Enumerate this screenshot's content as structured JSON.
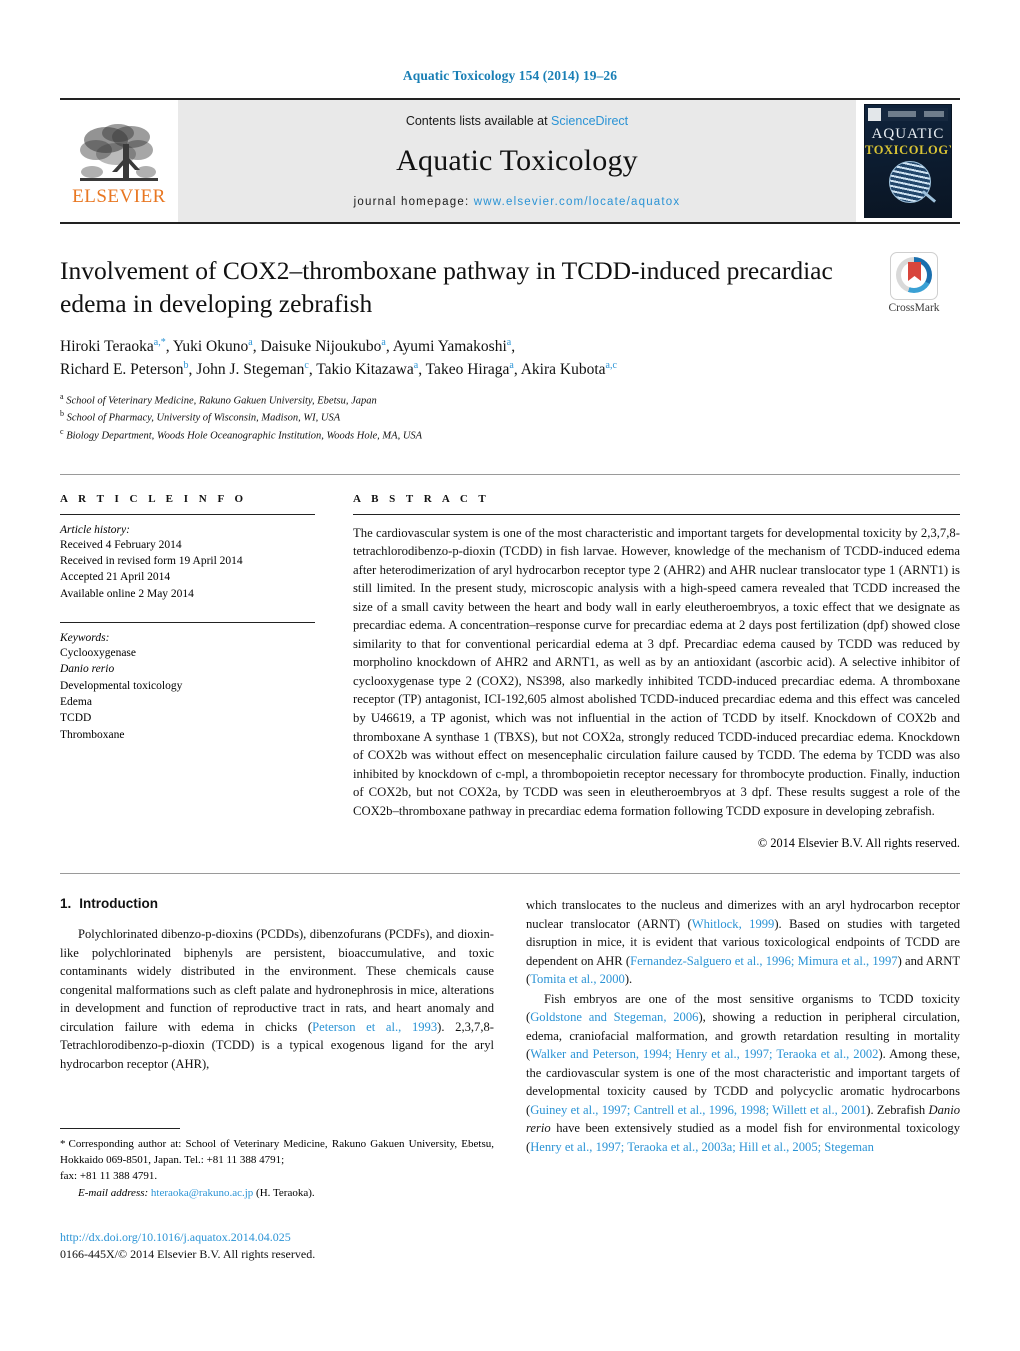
{
  "running_head": "Aquatic Toxicology 154 (2014) 19–26",
  "masthead": {
    "publisher_name": "ELSEVIER",
    "contents_prefix": "Contents lists available at ",
    "contents_link": "ScienceDirect",
    "journal_name": "Aquatic Toxicology",
    "homepage_prefix": "journal homepage: ",
    "homepage_url": "www.elsevier.com/locate/aquatox",
    "cover": {
      "line1": "AQUATIC",
      "line2": "TOXICOLOGY"
    }
  },
  "article": {
    "title": "Involvement of COX2–thromboxane pathway in TCDD-induced precardiac edema in developing zebrafish",
    "crossmark_label": "CrossMark",
    "authors_line1": "Hiroki Teraoka",
    "authors_html_line1": "Hiroki Teraoka a,*, Yuki Okuno a, Daisuke Nijoukubo a, Ayumi Yamakoshi a,",
    "authors_html_line2": "Richard E. Peterson b, John J. Stegeman c, Takio Kitazawa a, Takeo Hiraga a, Akira Kubota a,c",
    "affiliations": [
      {
        "marker": "a",
        "text": "School of Veterinary Medicine, Rakuno Gakuen University, Ebetsu, Japan"
      },
      {
        "marker": "b",
        "text": "School of Pharmacy, University of Wisconsin, Madison, WI, USA"
      },
      {
        "marker": "c",
        "text": "Biology Department, Woods Hole Oceanographic Institution, Woods Hole, MA, USA"
      }
    ]
  },
  "article_info": {
    "heading": "A R T I C L E   I N F O",
    "history_label": "Article history:",
    "history": [
      "Received 4 February 2014",
      "Received in revised form 19 April 2014",
      "Accepted 21 April 2014",
      "Available online 2 May 2014"
    ],
    "keywords_label": "Keywords:",
    "keywords": [
      "Cyclooxygenase",
      "Danio rerio",
      "Developmental toxicology",
      "Edema",
      "TCDD",
      "Thromboxane"
    ]
  },
  "abstract": {
    "heading": "A B S T R A C T",
    "text": "The cardiovascular system is one of the most characteristic and important targets for developmental toxicity by 2,3,7,8-tetrachlorodibenzo-p-dioxin (TCDD) in fish larvae. However, knowledge of the mechanism of TCDD-induced edema after heterodimerization of aryl hydrocarbon receptor type 2 (AHR2) and AHR nuclear translocator type 1 (ARNT1) is still limited. In the present study, microscopic analysis with a high-speed camera revealed that TCDD increased the size of a small cavity between the heart and body wall in early eleutheroembryos, a toxic effect that we designate as precardiac edema. A concentration–response curve for precardiac edema at 2 days post fertilization (dpf) showed close similarity to that for conventional pericardial edema at 3 dpf. Precardiac edema caused by TCDD was reduced by morpholino knockdown of AHR2 and ARNT1, as well as by an antioxidant (ascorbic acid). A selective inhibitor of cyclooxygenase type 2 (COX2), NS398, also markedly inhibited TCDD-induced precardiac edema. A thromboxane receptor (TP) antagonist, ICI-192,605 almost abolished TCDD-induced precardiac edema and this effect was canceled by U46619, a TP agonist, which was not influential in the action of TCDD by itself. Knockdown of COX2b and thromboxane A synthase 1 (TBXS), but not COX2a, strongly reduced TCDD-induced precardiac edema. Knockdown of COX2b was without effect on mesencephalic circulation failure caused by TCDD. The edema by TCDD was also inhibited by knockdown of c-mpl, a thrombopoietin receptor necessary for thrombocyte production. Finally, induction of COX2b, but not COX2a, by TCDD was seen in eleutheroembryos at 3 dpf. These results suggest a role of the COX2b–thromboxane pathway in precardiac edema formation following TCDD exposure in developing zebrafish.",
    "copyright": "© 2014 Elsevier B.V. All rights reserved."
  },
  "body": {
    "section_number": "1.",
    "section_title": "Introduction",
    "left_para_1_a": "Polychlorinated dibenzo-p-dioxins (PCDDs), dibenzofurans (PCDFs), and dioxin-like polychlorinated biphenyls are persistent, bioaccumulative, and toxic contaminants widely distributed in the environment. These chemicals cause congenital malformations such as cleft palate and hydronephrosis in mice, alterations in development and function of reproductive tract in rats, and heart anomaly and circulation failure with edema in chicks (",
    "left_cite_1": "Peterson et al., 1993",
    "left_para_1_b": "). 2,3,7,8-Tetrachlorodibenzo-p-dioxin (TCDD) is a typical exogenous ligand for the aryl hydrocarbon receptor (AHR),",
    "right_para_1_a": "which translocates to the nucleus and dimerizes with an aryl hydrocarbon receptor nuclear translocator (ARNT) (",
    "right_cite_1": "Whitlock, 1999",
    "right_para_1_b": "). Based on studies with targeted disruption in mice, it is evident that various toxicological endpoints of TCDD are dependent on AHR (",
    "right_cite_2": "Fernandez-Salguero et al., 1996; Mimura et al., 1997",
    "right_para_1_c": ") and ARNT (",
    "right_cite_3": "Tomita et al., 2000",
    "right_para_1_d": ").",
    "right_para_2_a": "Fish embryos are one of the most sensitive organisms to TCDD toxicity (",
    "right_cite_4": "Goldstone and Stegeman, 2006",
    "right_para_2_b": "), showing a reduction in peripheral circulation, edema, craniofacial malformation, and growth retardation resulting in mortality (",
    "right_cite_5": "Walker and Peterson, 1994; Henry et al., 1997; Teraoka et al., 2002",
    "right_para_2_c": "). Among these, the cardiovascular system is one of the most characteristic and important targets of developmental toxicity caused by TCDD and polycyclic aromatic hydrocarbons (",
    "right_cite_6": "Guiney et al., 1997; Cantrell et al., 1996, 1998; Willett et al., 2001",
    "right_para_2_d": "). Zebrafish ",
    "right_para_2_italic": "Danio rerio",
    "right_para_2_e": " have been extensively studied as a model fish for environmental toxicology (",
    "right_cite_7": "Henry et al., 1997; Teraoka et al., 2003a; Hill et al., 2005; Stegeman"
  },
  "footnotes": {
    "corresponding_star": "*",
    "corresponding_text": "Corresponding author at: School of Veterinary Medicine, Rakuno Gakuen University, Ebetsu, Hokkaido 069-8501, Japan. Tel.: +81 11 388 4791;",
    "fax_text": "fax: +81 11 388 4791.",
    "email_label": "E-mail address:",
    "email": "hteraoka@rakuno.ac.jp",
    "email_suffix": "(H. Teraoka).",
    "doi": "http://dx.doi.org/10.1016/j.aquatox.2014.04.025",
    "issn_line": "0166-445X/© 2014 Elsevier B.V. All rights reserved."
  },
  "colors": {
    "link": "#2a93d5",
    "elsevier_orange": "#E87722",
    "band_gray": "#e9e9e9"
  }
}
